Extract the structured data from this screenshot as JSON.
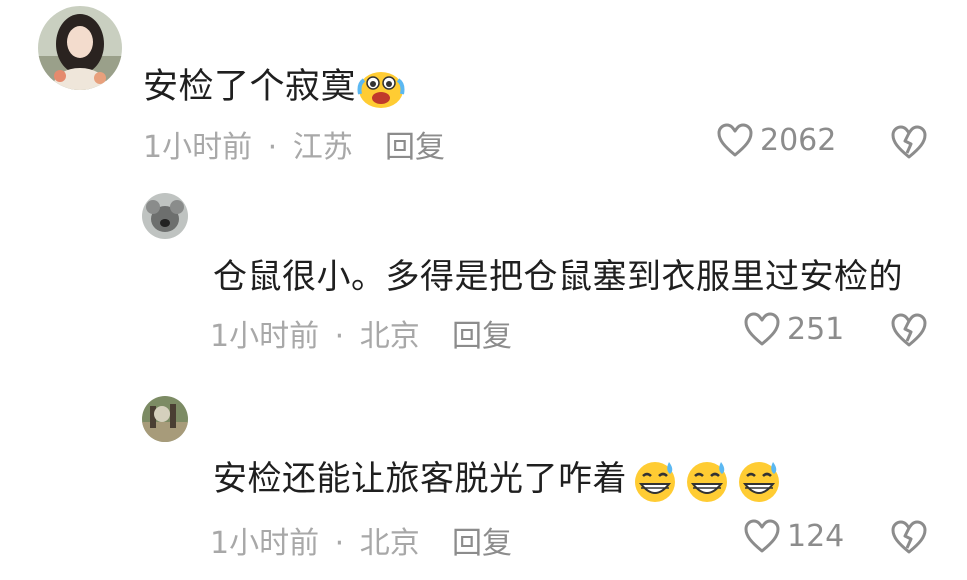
{
  "comments": [
    {
      "text": "安检了个寂寞",
      "emoji_icons": [
        "crying-laughing-emoji-icon"
      ],
      "time": "1小时前",
      "separator": "·",
      "location": "江苏",
      "reply_label": "回复",
      "like_count": "2062"
    },
    {
      "text": "仓鼠很小。多得是把仓鼠塞到衣服里过安检的",
      "emoji_icons": [],
      "time": "1小时前",
      "separator": "·",
      "location": "北京",
      "reply_label": "回复",
      "like_count": "251"
    },
    {
      "text": "安检还能让旅客脱光了咋着",
      "emoji_icons": [
        "sweat-grin-emoji-icon",
        "sweat-grin-emoji-icon",
        "sweat-grin-emoji-icon"
      ],
      "time": "1小时前",
      "separator": "·",
      "location": "北京",
      "reply_label": "回复",
      "like_count": "124"
    }
  ],
  "colors": {
    "text": "#1f1f1f",
    "meta": "#a8a8a8",
    "action": "#8c8c8c",
    "emoji_yellow": "#ffcc33"
  }
}
